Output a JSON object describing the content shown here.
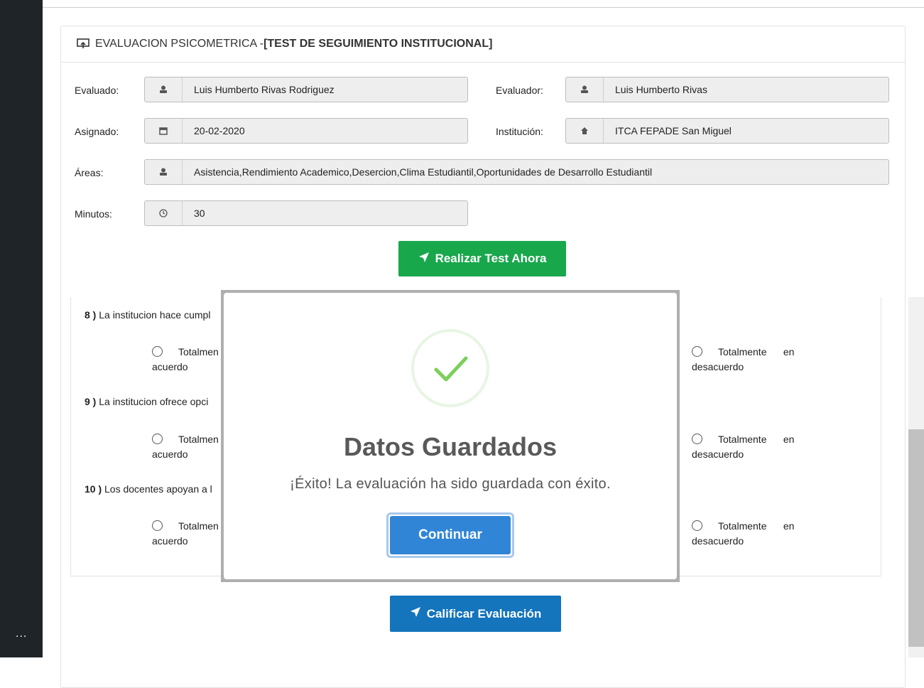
{
  "sidebar": {
    "more_label": "..."
  },
  "panel": {
    "title_prefix": "EVALUACION PSICOMETRICA - ",
    "title_bold": "[TEST DE SEGUIMIENTO INSTITUCIONAL]"
  },
  "form": {
    "evaluado": {
      "label": "Evaluado:",
      "value": "Luis Humberto Rivas Rodriguez",
      "icon": "user-icon"
    },
    "evaluador": {
      "label": "Evaluador:",
      "value": "Luis Humberto Rivas",
      "icon": "user-icon"
    },
    "asignado": {
      "label": "Asignado:",
      "value": "20-02-2020",
      "icon": "calendar-icon"
    },
    "institucion": {
      "label": "Institución:",
      "value": "ITCA FEPADE San Miguel",
      "icon": "home-icon"
    },
    "areas": {
      "label": "Áreas:",
      "value": "Asistencia,Rendimiento Academico,Desercion,Clima Estudiantil,Oportunidades de Desarrollo Estudiantil",
      "icon": "user-icon"
    },
    "minutos": {
      "label": "Minutos:",
      "value": "30",
      "icon": "clock-icon"
    }
  },
  "realizar_button": "Realizar Test Ahora",
  "questions": [
    {
      "num": "8 )",
      "text": "La institucion hace cumpl",
      "left_opt_a": "Totalmen",
      "left_opt_b": "acuerdo",
      "right_opt_a": "Totalmente",
      "right_opt_en": "en",
      "right_opt_b": "desacuerdo"
    },
    {
      "num": "9 )",
      "text": "La institucion ofrece opci",
      "left_opt_a": "Totalmen",
      "left_opt_b": "acuerdo",
      "right_opt_a": "Totalmente",
      "right_opt_en": "en",
      "right_opt_b": "desacuerdo"
    },
    {
      "num": "10 )",
      "text": "Los docentes apoyan a l",
      "left_opt_a": "Totalmen",
      "left_opt_b": "acuerdo",
      "right_opt_a": "Totalmente",
      "right_opt_en": "en",
      "right_opt_b": "desacuerdo"
    }
  ],
  "calificar_button": "Calificar Evaluación",
  "modal": {
    "title": "Datos Guardados",
    "message": "¡Éxito! La evaluación ha sido guardada con éxito.",
    "confirm_button": "Continuar",
    "success_color": "#5fc43a"
  }
}
